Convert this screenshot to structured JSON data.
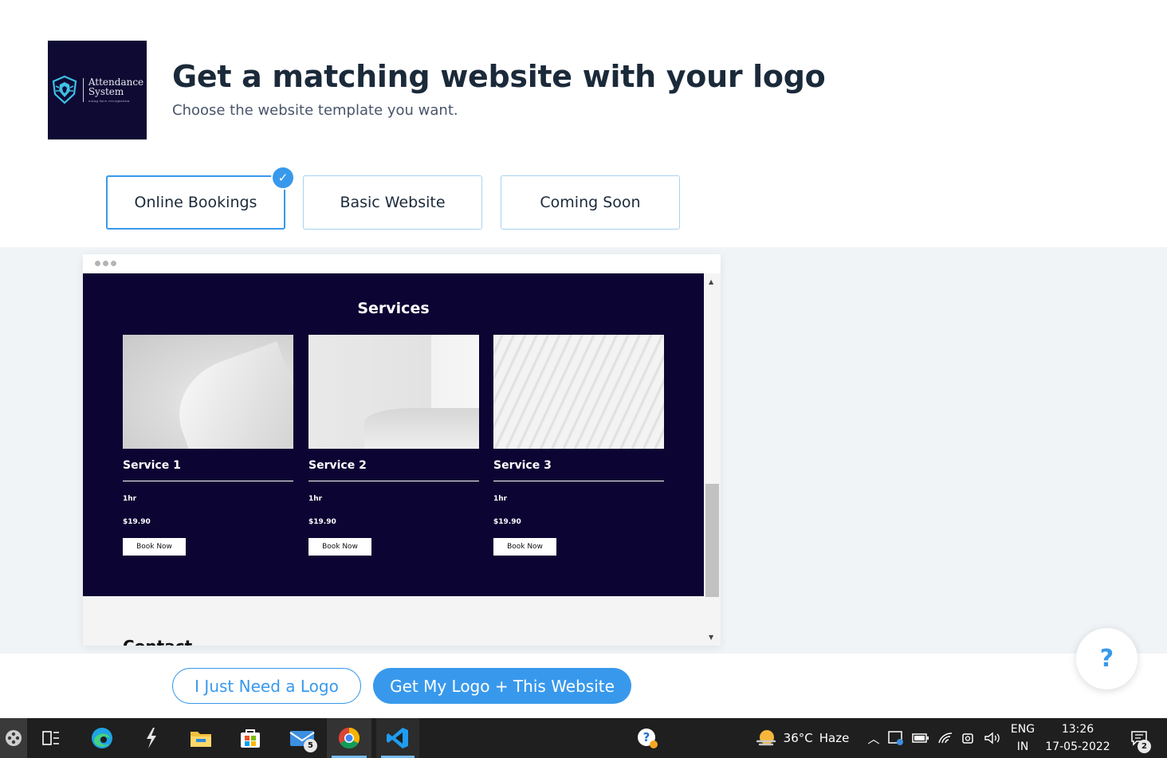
{
  "header": {
    "logo": {
      "line1": "Attendance",
      "line2": "System",
      "tagline": "using face recognition",
      "bg_color": "#0e0a33"
    },
    "title": "Get a matching website with your logo",
    "subtitle": "Choose the website template you want."
  },
  "tabs": [
    {
      "label": "Online Bookings",
      "selected": true
    },
    {
      "label": "Basic Website",
      "selected": false
    },
    {
      "label": "Coming Soon",
      "selected": false
    }
  ],
  "preview": {
    "section_title": "Services",
    "services": [
      {
        "name": "Service 1",
        "duration": "1hr",
        "price": "$19.90",
        "button": "Book Now"
      },
      {
        "name": "Service 2",
        "duration": "1hr",
        "price": "$19.90",
        "button": "Book Now"
      },
      {
        "name": "Service 3",
        "duration": "1hr",
        "price": "$19.90",
        "button": "Book Now"
      }
    ],
    "next_section_peek": "Contact",
    "section_bg": "#0c0533"
  },
  "actions": {
    "secondary": "I Just Need a Logo",
    "primary": "Get My Logo + This Website",
    "help": "?"
  },
  "colors": {
    "accent": "#3899ec",
    "title": "#1b2a3a"
  },
  "taskbar": {
    "apps": [
      {
        "name": "start-icon"
      },
      {
        "name": "task-view-icon"
      },
      {
        "name": "edge-icon"
      },
      {
        "name": "visual-studio-icon"
      },
      {
        "name": "file-explorer-icon"
      },
      {
        "name": "microsoft-store-icon"
      },
      {
        "name": "mail-icon",
        "badge": "5"
      },
      {
        "name": "chrome-icon",
        "active": true
      },
      {
        "name": "vscode-icon",
        "active": true
      }
    ],
    "weather": {
      "temp": "36°C",
      "condition": "Haze"
    },
    "language": {
      "line1": "ENG",
      "line2": "IN"
    },
    "clock": {
      "time": "13:26",
      "date": "17-05-2022"
    },
    "notifications_badge": "2"
  }
}
